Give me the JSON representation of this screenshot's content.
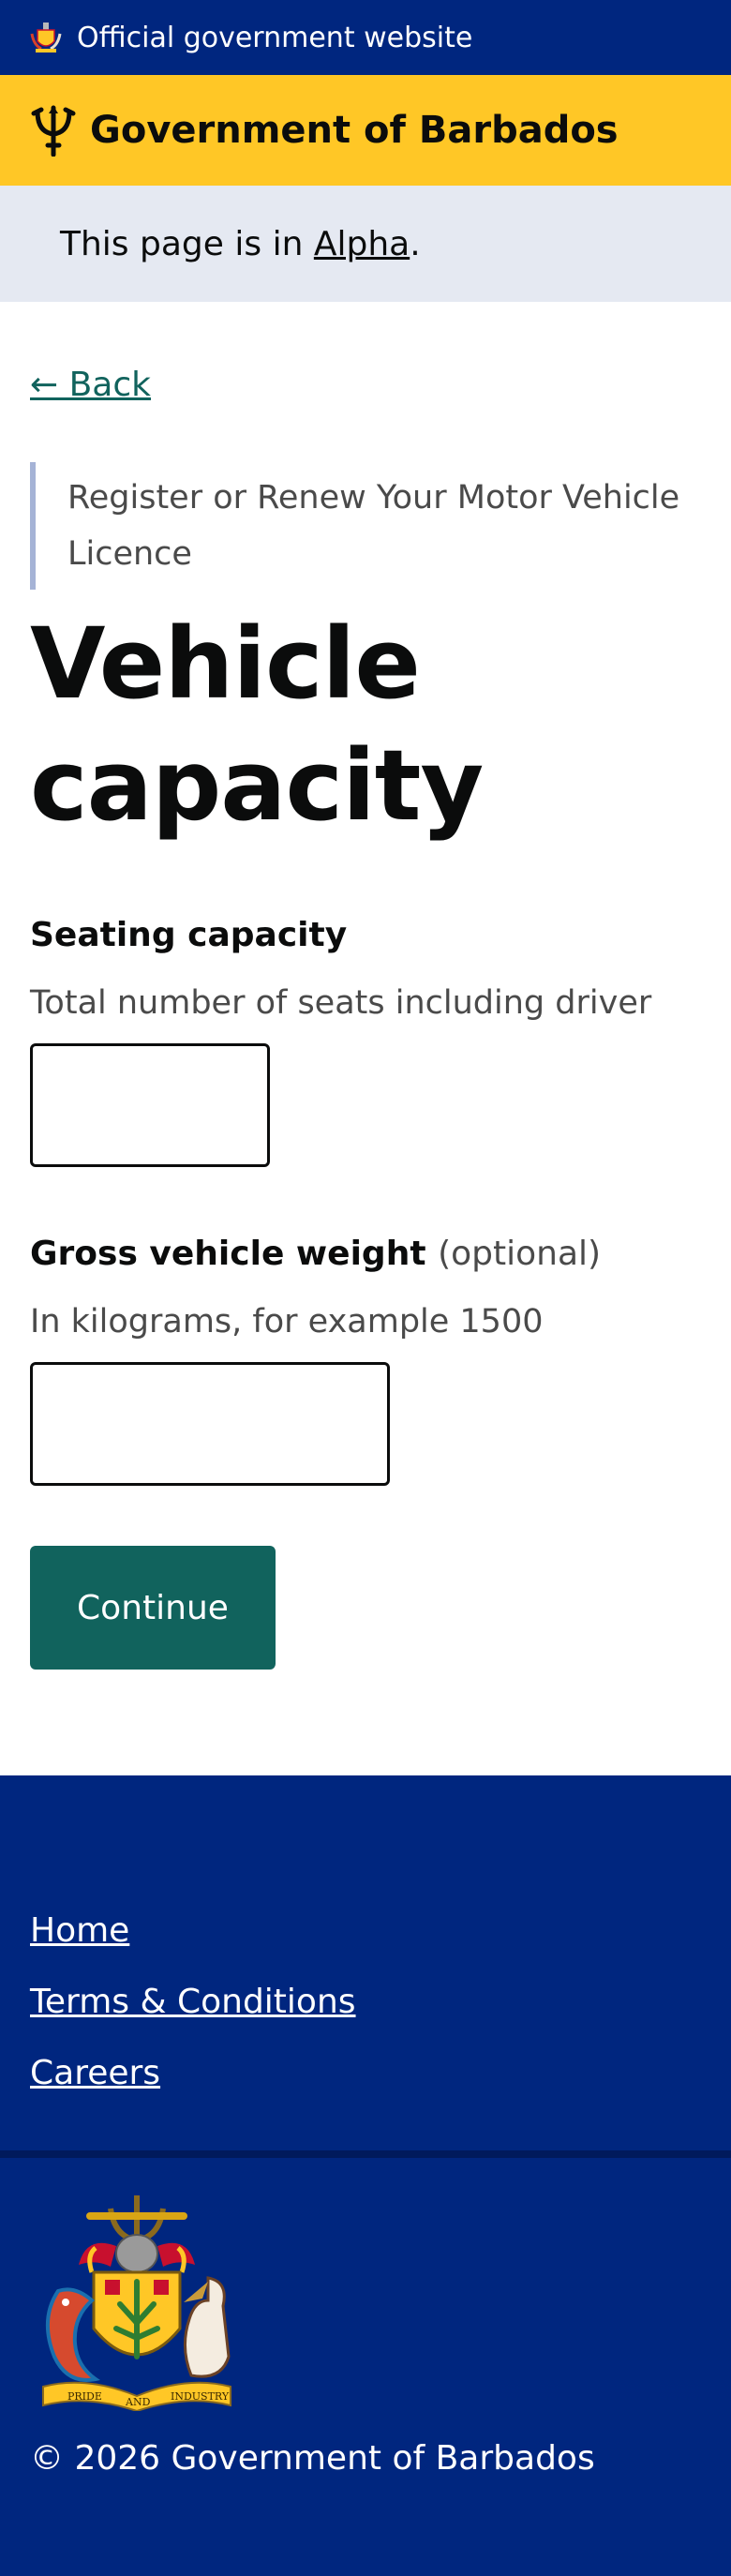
{
  "official_bar": {
    "text": "Official government website",
    "icon": "coat-of-arms-icon"
  },
  "brand": {
    "name": "Government of Barbados",
    "icon": "trident-icon"
  },
  "phase_banner": {
    "prefix": "This page is in ",
    "phase": "Alpha",
    "suffix": "."
  },
  "back": {
    "label": "← Back"
  },
  "caption": "Register or Renew Your Motor Vehicle Licence",
  "heading": "Vehicle capacity",
  "seating": {
    "label": "Seating capacity",
    "hint": "Total number of seats including driver",
    "value": ""
  },
  "weight": {
    "label": "Gross vehicle weight",
    "optional": "(optional)",
    "hint": "In kilograms, for example 1500",
    "value": ""
  },
  "continue_label": "Continue",
  "footer": {
    "links": [
      "Home",
      "Terms & Conditions",
      "Careers"
    ],
    "motto": [
      "PRIDE",
      "AND",
      "INDUSTRY"
    ],
    "copyright": "© 2026 Government of Barbados"
  },
  "colors": {
    "navy": "#00267f",
    "gold": "#ffc726",
    "teal": "#11635d",
    "phase_bg": "#e5e9f2"
  }
}
